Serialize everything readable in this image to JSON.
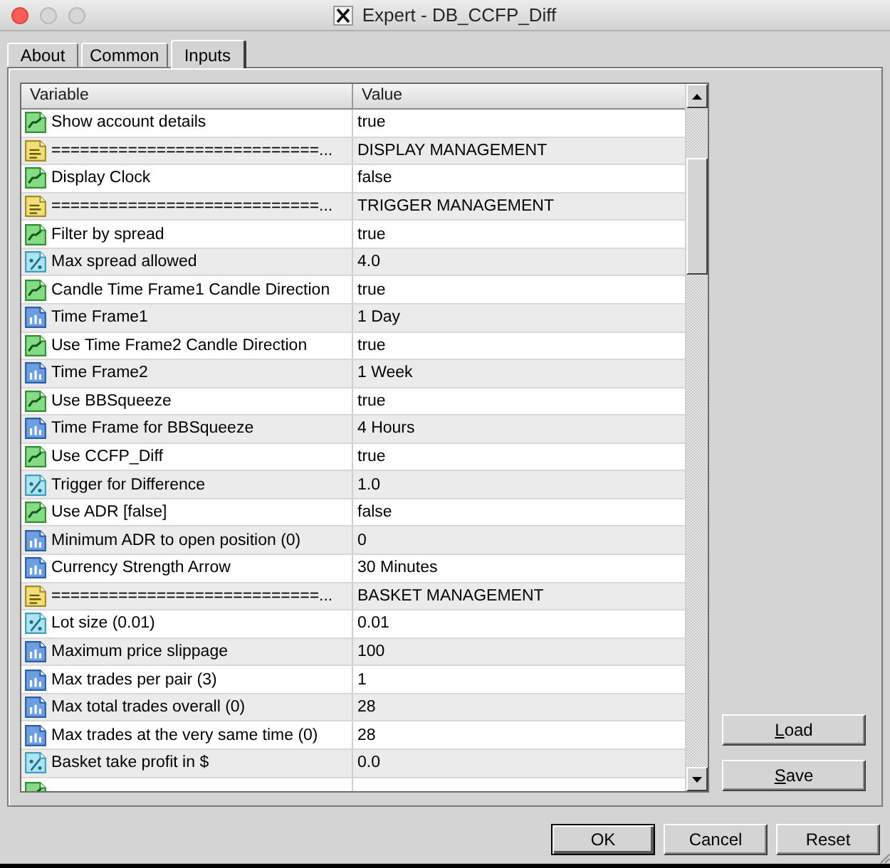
{
  "window": {
    "title": "Expert - DB_CCFP_Diff"
  },
  "tabs": [
    {
      "label": "About",
      "selected": false
    },
    {
      "label": "Common",
      "selected": false
    },
    {
      "label": "Inputs",
      "selected": true
    }
  ],
  "inputs_table": {
    "columns": [
      "Variable",
      "Value"
    ],
    "rows": [
      {
        "kind": "bool",
        "variable": "Show account details",
        "value": "true"
      },
      {
        "kind": "string",
        "variable": "============================...",
        "value": "DISPLAY MANAGEMENT"
      },
      {
        "kind": "bool",
        "variable": "Display Clock",
        "value": "false"
      },
      {
        "kind": "string",
        "variable": "============================...",
        "value": "TRIGGER MANAGEMENT"
      },
      {
        "kind": "bool",
        "variable": "Filter by spread",
        "value": "true"
      },
      {
        "kind": "double",
        "variable": "Max spread allowed",
        "value": "4.0"
      },
      {
        "kind": "bool",
        "variable": "Candle Time Frame1 Candle Direction",
        "value": "true"
      },
      {
        "kind": "int",
        "variable": "Time Frame1",
        "value": "1 Day"
      },
      {
        "kind": "bool",
        "variable": "Use Time Frame2 Candle Direction",
        "value": "true"
      },
      {
        "kind": "int",
        "variable": "Time Frame2",
        "value": "1 Week"
      },
      {
        "kind": "bool",
        "variable": "Use BBSqueeze",
        "value": "true"
      },
      {
        "kind": "int",
        "variable": "Time Frame for BBSqueeze",
        "value": "4 Hours"
      },
      {
        "kind": "bool",
        "variable": "Use CCFP_Diff",
        "value": "true"
      },
      {
        "kind": "double",
        "variable": "Trigger for Difference",
        "value": "1.0"
      },
      {
        "kind": "bool",
        "variable": "Use ADR [false]",
        "value": "false"
      },
      {
        "kind": "int",
        "variable": "Minimum ADR to open position (0)",
        "value": "0"
      },
      {
        "kind": "int",
        "variable": "Currency Strength Arrow",
        "value": "30 Minutes"
      },
      {
        "kind": "string",
        "variable": "============================...",
        "value": "BASKET MANAGEMENT"
      },
      {
        "kind": "double",
        "variable": "Lot size (0.01)",
        "value": "0.01"
      },
      {
        "kind": "int",
        "variable": "Maximum price slippage",
        "value": "100"
      },
      {
        "kind": "int",
        "variable": "Max trades per pair (3)",
        "value": "1"
      },
      {
        "kind": "int",
        "variable": "Max total trades overall (0)",
        "value": "28"
      },
      {
        "kind": "int",
        "variable": "Max trades at the very same time (0)",
        "value": "28"
      },
      {
        "kind": "double",
        "variable": "Basket take profit in $",
        "value": "0.0"
      },
      {
        "kind": "bool"
      }
    ]
  },
  "side_buttons": [
    "Load",
    "Save"
  ],
  "buttons": [
    {
      "label": "OK",
      "default": true
    },
    {
      "label": "Cancel",
      "default": false
    },
    {
      "label": "Reset",
      "default": false
    }
  ]
}
